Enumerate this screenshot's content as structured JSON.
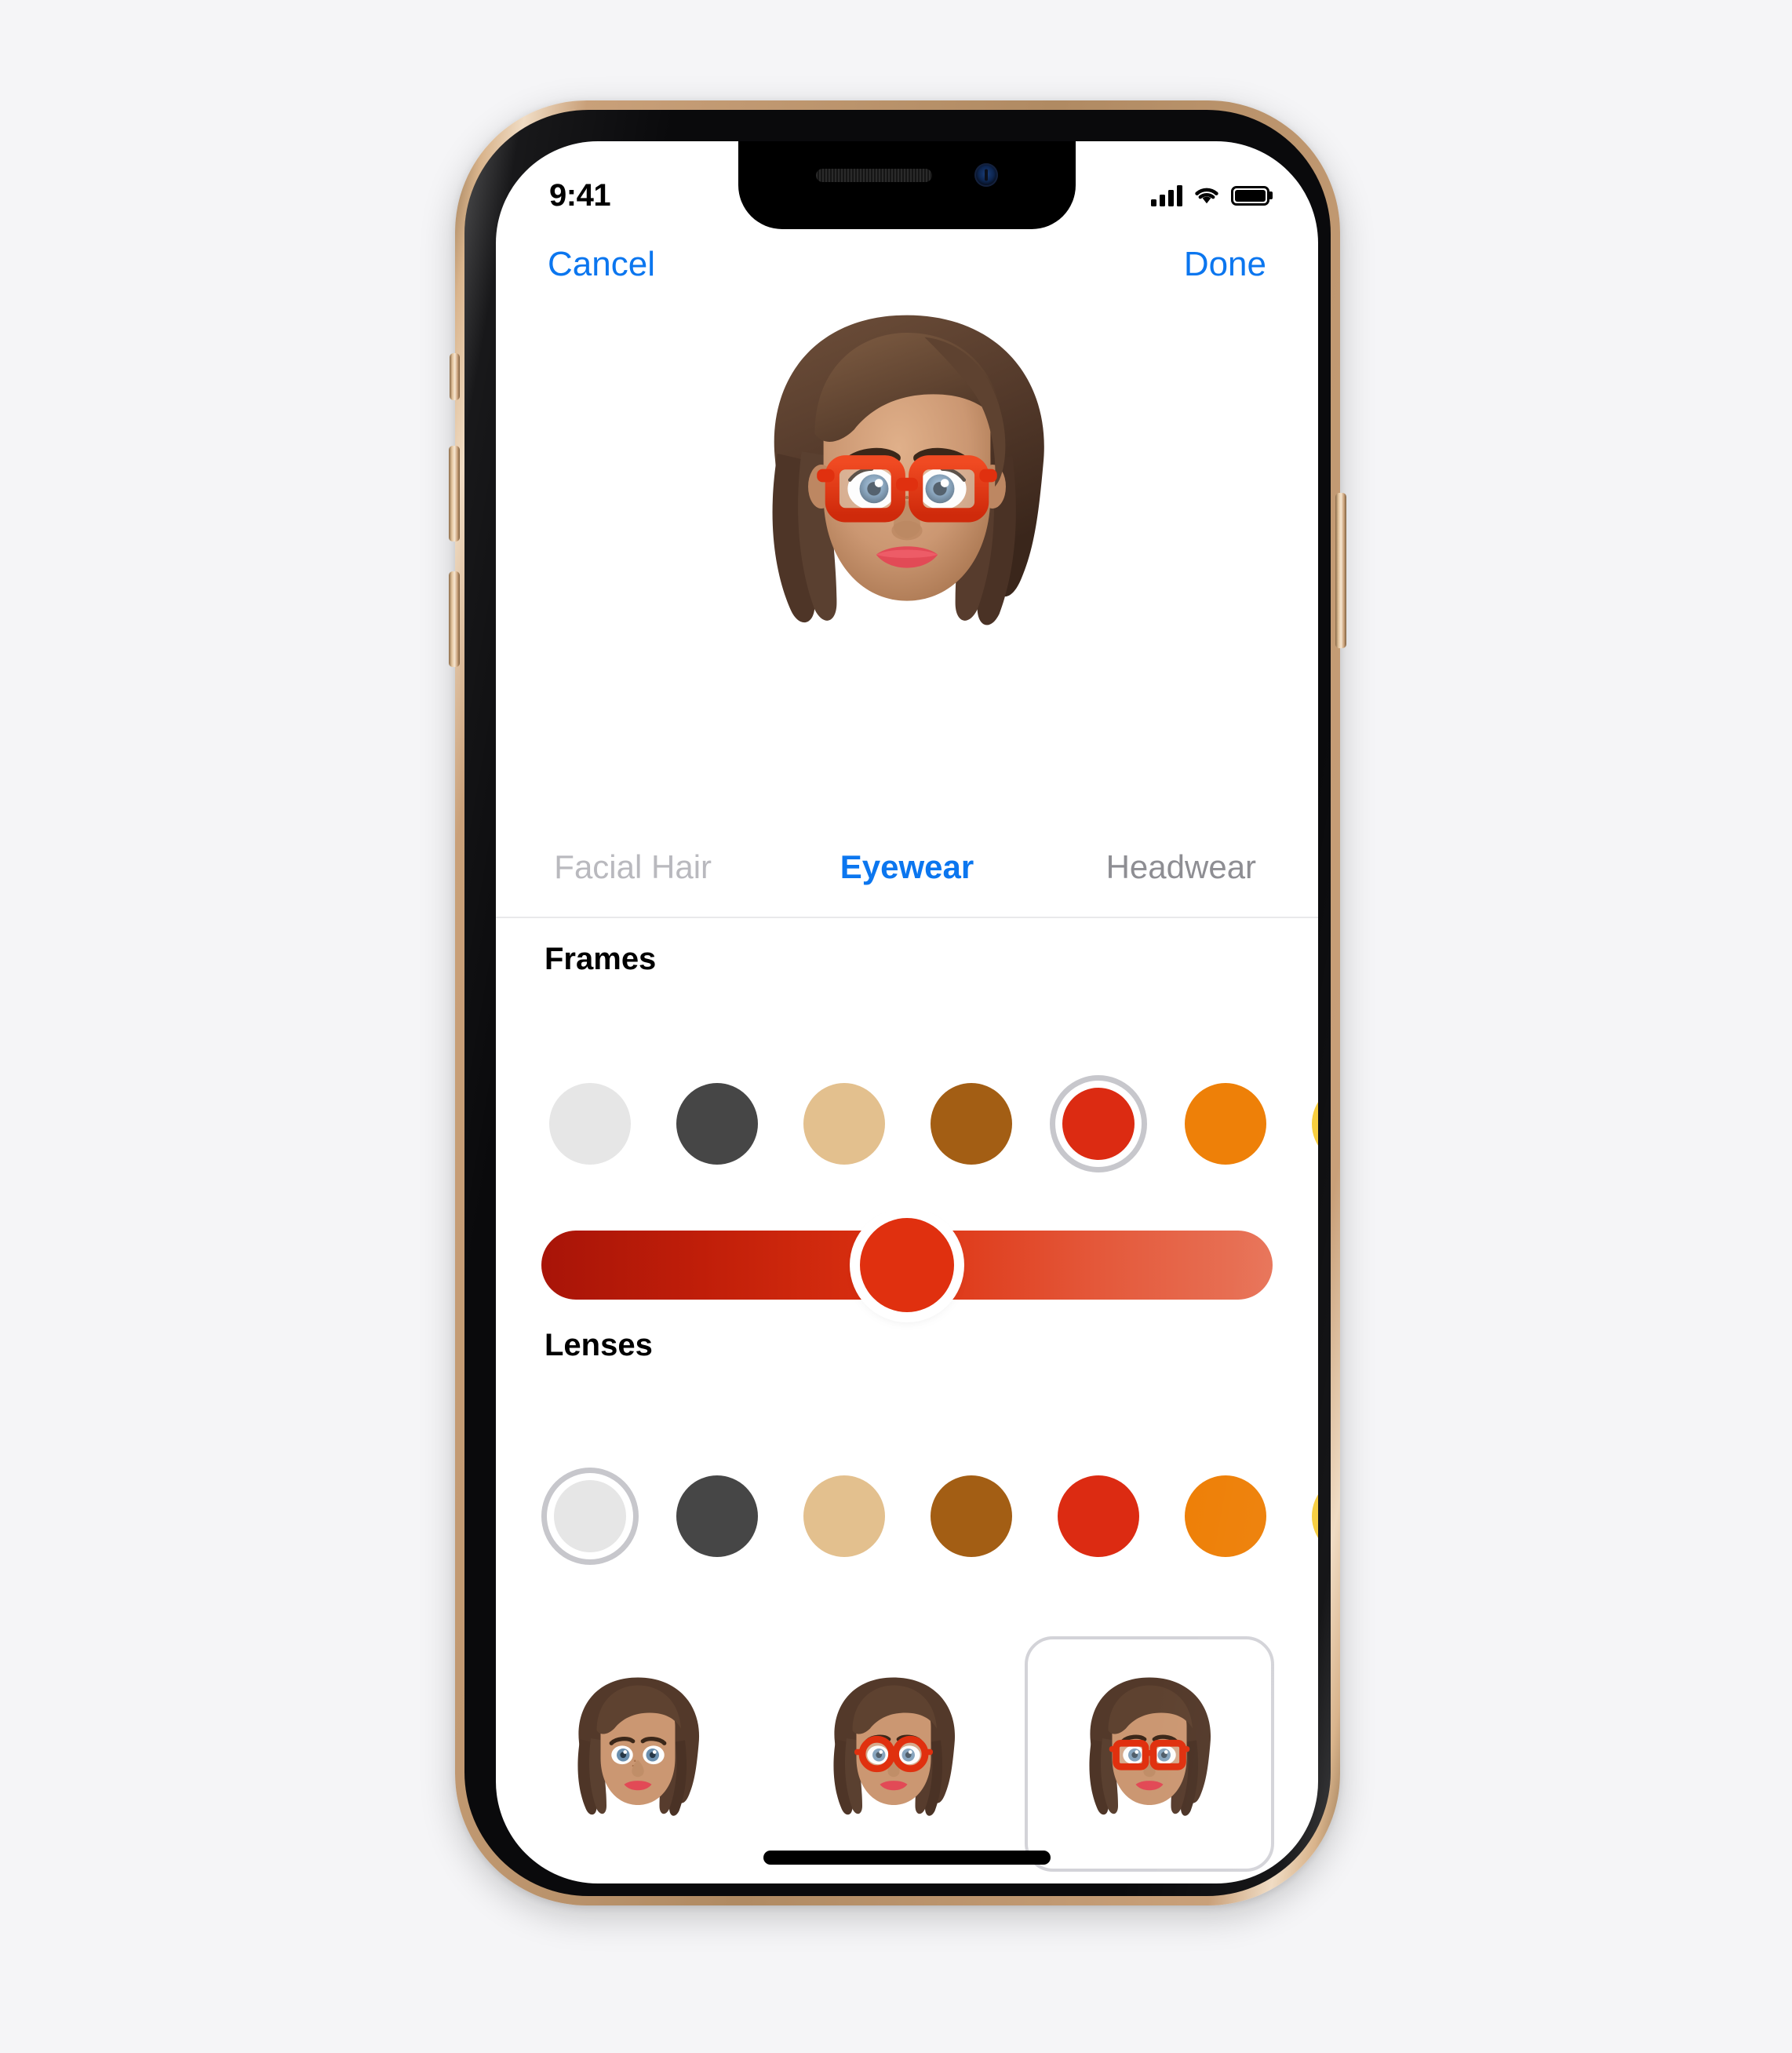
{
  "device": {
    "model": "iPhone XS",
    "frame_color": "#c9a079",
    "bezel_color": "#0a0a0c"
  },
  "status_bar": {
    "time": "9:41",
    "signal_icon": "cellular-signal-icon",
    "signal_bars": 4,
    "wifi_icon": "wifi-icon",
    "battery_icon": "battery-full-icon",
    "battery_level": 100
  },
  "nav_bar": {
    "cancel_label": "Cancel",
    "done_label": "Done",
    "tint_color": "#0b76ef"
  },
  "preview": {
    "name": "memoji-preview",
    "skin_tone": "#c99470",
    "hair_color": "#5c4131",
    "eye_color": "#6e93b8",
    "glasses_color": "#e0300f",
    "lip_color": "#e04a4f"
  },
  "tabs": [
    {
      "label": "Facial Hair",
      "active": false
    },
    {
      "label": "Eyewear",
      "active": true
    },
    {
      "label": "Headwear",
      "active": false
    }
  ],
  "sections": [
    {
      "title": "Frames",
      "selected_index": 4,
      "swatches": [
        {
          "name": "white",
          "color": "#e6e6e6"
        },
        {
          "name": "charcoal",
          "color": "#464646"
        },
        {
          "name": "tan",
          "color": "#e3c08e"
        },
        {
          "name": "brown",
          "color": "#a35e14"
        },
        {
          "name": "red",
          "color": "#dc2b12"
        },
        {
          "name": "orange",
          "color": "#ee8008"
        },
        {
          "name": "yellow",
          "color": "#f7cd3c"
        }
      ],
      "slider": {
        "name": "frame-shade-slider",
        "value": 50,
        "gradient_start": "#a81408",
        "gradient_mid": "#dd3211",
        "gradient_end": "#e8755a"
      }
    },
    {
      "title": "Lenses",
      "selected_index": 0,
      "swatches": [
        {
          "name": "white",
          "color": "#e6e6e6"
        },
        {
          "name": "charcoal",
          "color": "#464646"
        },
        {
          "name": "tan",
          "color": "#e3c08e"
        },
        {
          "name": "brown",
          "color": "#a35e14"
        },
        {
          "name": "red",
          "color": "#dc2b12"
        },
        {
          "name": "orange",
          "color": "#ee8008"
        },
        {
          "name": "yellow",
          "color": "#f7cd3c"
        }
      ],
      "slider": null
    }
  ],
  "thumbnails": {
    "selected_index": 2,
    "items": [
      {
        "name": "no-glasses",
        "glasses": "none"
      },
      {
        "name": "round-glasses",
        "glasses": "round",
        "color": "#e0300f"
      },
      {
        "name": "square-glasses",
        "glasses": "square",
        "color": "#e0300f"
      }
    ]
  },
  "home_indicator": {
    "name": "home-indicator"
  }
}
